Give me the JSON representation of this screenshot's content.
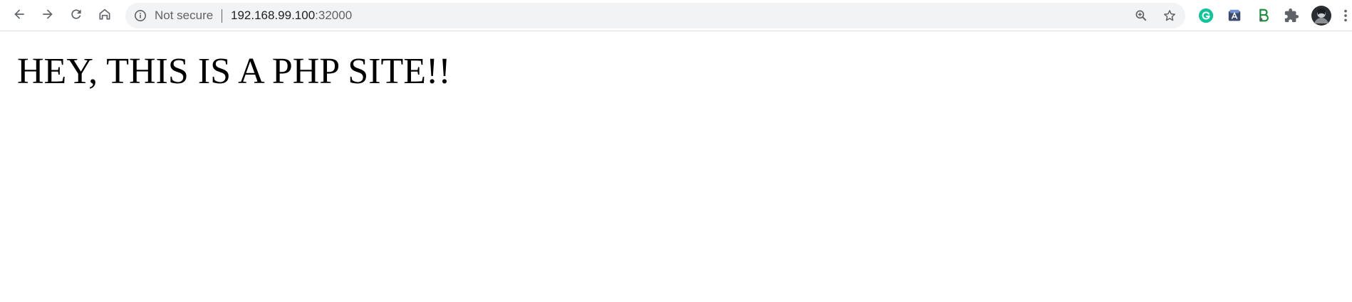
{
  "browser": {
    "nav": {
      "back_icon": "arrow-left-icon",
      "forward_icon": "arrow-right-icon",
      "reload_icon": "reload-icon",
      "home_icon": "home-icon"
    },
    "omnibox": {
      "security_label": "Not secure",
      "url_host": "192.168.99.100",
      "url_port": ":32000",
      "zoom_icon": "zoom-in-icon",
      "bookmark_icon": "star-icon"
    },
    "extensions": [
      {
        "name": "grammarly-extension-icon",
        "color": "#15c39a"
      },
      {
        "name": "translate-extension-icon",
        "color": "#3c4a6b"
      },
      {
        "name": "green-extension-icon",
        "color": "#1e8e3e"
      },
      {
        "name": "puzzle-extension-icon",
        "color": "#5f6368"
      }
    ],
    "profile_icon": "avatar-icon",
    "menu_icon": "more-vertical-icon"
  },
  "page": {
    "heading": "HEY, THIS IS A PHP SITE!!"
  }
}
